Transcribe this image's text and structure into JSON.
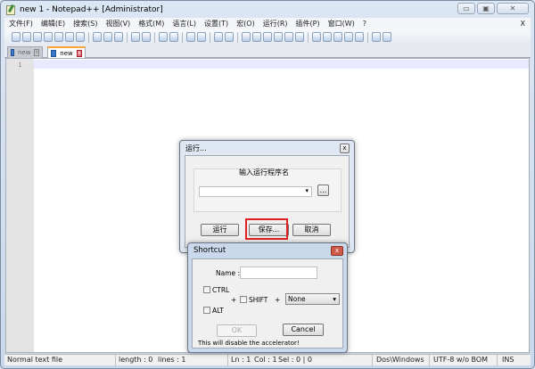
{
  "window": {
    "title": "new  1 - Notepad++ [Administrator]"
  },
  "menu": [
    "文件(F)",
    "编辑(E)",
    "搜索(S)",
    "视图(V)",
    "格式(M)",
    "语言(L)",
    "设置(T)",
    "宏(O)",
    "运行(R)",
    "插件(P)",
    "窗口(W)",
    "?"
  ],
  "menu_close": "X",
  "toolbar_icons": [
    "new-file-icon",
    "open-icon",
    "save-icon",
    "save-all-icon",
    "close-icon",
    "close-all-icon",
    "print-icon",
    "sep",
    "cut-icon",
    "copy-icon",
    "paste-icon",
    "sep",
    "undo-icon",
    "redo-icon",
    "sep",
    "find-icon",
    "replace-icon",
    "sep",
    "zoom-in-icon",
    "zoom-out-icon",
    "sep",
    "sync-v-icon",
    "sync-h-icon",
    "sep",
    "wrap-icon",
    "all-chars-icon",
    "indent-guide-icon",
    "doc-map-icon",
    "function-list-icon",
    "folder-icon",
    "sep",
    "record-icon",
    "stop-icon",
    "play-icon",
    "play-multi-icon",
    "save-macro-icon",
    "sep",
    "spellcheck-icon",
    "explorer-icon"
  ],
  "tabs": [
    {
      "label": "new"
    },
    {
      "label": "new"
    }
  ],
  "editor": {
    "line_numbers": [
      "1"
    ]
  },
  "status": {
    "type": "Normal text file",
    "length": "length : 0",
    "lines": "lines : 1",
    "ln": "Ln : 1",
    "col": "Col : 1",
    "sel": "Sel : 0 | 0",
    "eol": "Dos\\Windows",
    "encoding": "UTF-8 w/o BOM",
    "mode": "INS"
  },
  "run_dialog": {
    "title": "运行...",
    "group_label": "输入运行程序名",
    "command_value": "",
    "browse": "...",
    "run": "运行",
    "save": "保存...",
    "cancel": "取消",
    "close": "x"
  },
  "shortcut_dialog": {
    "title": "Shortcut",
    "name_label": "Name :",
    "name_value": "",
    "ctrl": "CTRL",
    "alt": "ALT",
    "shift": "SHIFT",
    "plus": "+",
    "key": "None",
    "ok": "OK",
    "cancel": "Cancel",
    "note": "This will disable the accelerator!"
  },
  "highlight_color": "#e02020"
}
